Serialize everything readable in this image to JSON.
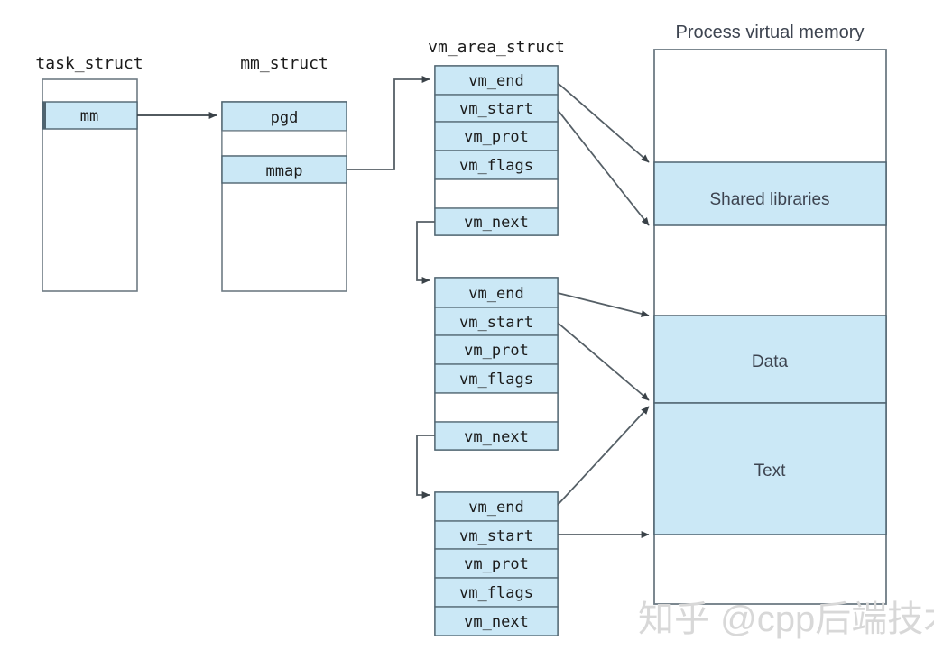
{
  "diagram": {
    "title_task_struct": "task_struct",
    "title_mm_struct": "mm_struct",
    "title_vm_area_struct": "vm_area_struct",
    "title_process_memory": "Process virtual memory",
    "watermark": "知乎 @cpp后端技术",
    "colors": {
      "fill_blue": "#cbe8f6",
      "fill_blue_light": "#d2ecf8",
      "stroke_box": "#6e7b84",
      "stroke_row": "#4f6470",
      "stroke_arrow": "#555f66",
      "text_dark": "#1b1b1b",
      "text_slate": "#3d4450",
      "background": "#ffffff",
      "watermark": "#d8d8d8"
    },
    "task_struct": {
      "label": "task_struct",
      "rows": [
        {
          "label": "",
          "filled": false
        },
        {
          "label": "mm",
          "filled": true
        },
        {
          "label": "",
          "filled": false
        }
      ]
    },
    "mm_struct": {
      "label": "mm_struct",
      "rows": [
        {
          "label": "pgd",
          "filled": true
        },
        {
          "label": "",
          "filled": false
        },
        {
          "label": "mmap",
          "filled": true
        },
        {
          "label": "",
          "filled": false
        }
      ]
    },
    "vm_areas": [
      {
        "name": "vm-area-struct-1",
        "rows": [
          {
            "label": "vm_end",
            "filled": true
          },
          {
            "label": "vm_start",
            "filled": true
          },
          {
            "label": "vm_prot",
            "filled": true
          },
          {
            "label": "vm_flags",
            "filled": true
          },
          {
            "label": "",
            "filled": false
          },
          {
            "label": "vm_next",
            "filled": true
          }
        ]
      },
      {
        "name": "vm-area-struct-2",
        "rows": [
          {
            "label": "vm_end",
            "filled": true
          },
          {
            "label": "vm_start",
            "filled": true
          },
          {
            "label": "vm_prot",
            "filled": true
          },
          {
            "label": "vm_flags",
            "filled": true
          },
          {
            "label": "",
            "filled": false
          },
          {
            "label": "vm_next",
            "filled": true
          }
        ]
      },
      {
        "name": "vm-area-struct-3",
        "rows": [
          {
            "label": "vm_end",
            "filled": true
          },
          {
            "label": "vm_start",
            "filled": true
          },
          {
            "label": "vm_prot",
            "filled": true
          },
          {
            "label": "vm_flags",
            "filled": true
          },
          {
            "label": "vm_next",
            "filled": true
          }
        ]
      }
    ],
    "process_memory": {
      "label": "Process virtual memory",
      "segments": [
        {
          "label": "",
          "filled": false
        },
        {
          "label": "Shared libraries",
          "filled": true
        },
        {
          "label": "",
          "filled": false
        },
        {
          "label": "Data",
          "filled": true
        },
        {
          "label": "Text",
          "filled": true
        },
        {
          "label": "",
          "filled": false
        }
      ]
    }
  }
}
